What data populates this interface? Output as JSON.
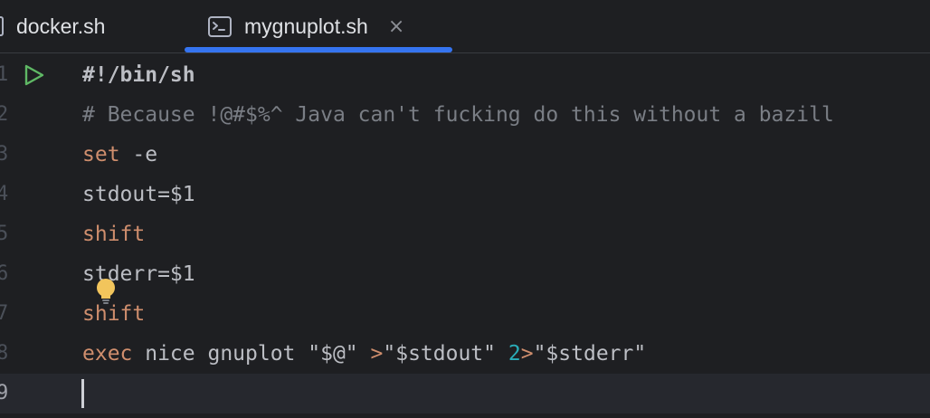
{
  "tabs": [
    {
      "label": "docker.sh",
      "icon": "file-icon",
      "active": false
    },
    {
      "label": "mygnuplot.sh",
      "icon": "terminal-icon",
      "active": true,
      "close": "×"
    }
  ],
  "colors": {
    "background": "#1e1f22",
    "current_line": "#26282e",
    "accent": "#3574f0",
    "keyword": "#cf8e6d",
    "comment": "#7a7e85",
    "number": "#2aacb8",
    "text": "#bcbec4",
    "run_icon": "#5fb865",
    "bulb": "#f2c55c"
  },
  "gutter": {
    "run_icon": "run-icon",
    "line_numbers": [
      "1",
      "2",
      "3",
      "4",
      "5",
      "6",
      "7",
      "8",
      "9"
    ]
  },
  "code": {
    "line1": {
      "shebang": "#!/bin/sh"
    },
    "line2": {
      "comment": "# Because !@#$%^ Java can't fucking do this without a bazill"
    },
    "line3": {
      "keyword": "set",
      "rest": " -e"
    },
    "line4": {
      "text": "stdout=$1"
    },
    "line5": {
      "keyword": "shift"
    },
    "line6": {
      "text": "stderr=$1"
    },
    "line7": {
      "keyword": "shift"
    },
    "line8": {
      "keyword": "exec",
      "cmd": " nice gnuplot ",
      "arg1": "\"$@\"",
      "space1": " ",
      "redir1": ">",
      "arg2": "\"$stdout\"",
      "space2": " ",
      "fd": "2",
      "redir2": ">",
      "arg3": "\"$stderr\""
    },
    "line9": {
      "text": ""
    }
  },
  "intention_icon": "lightbulb-icon",
  "current_line": "9"
}
